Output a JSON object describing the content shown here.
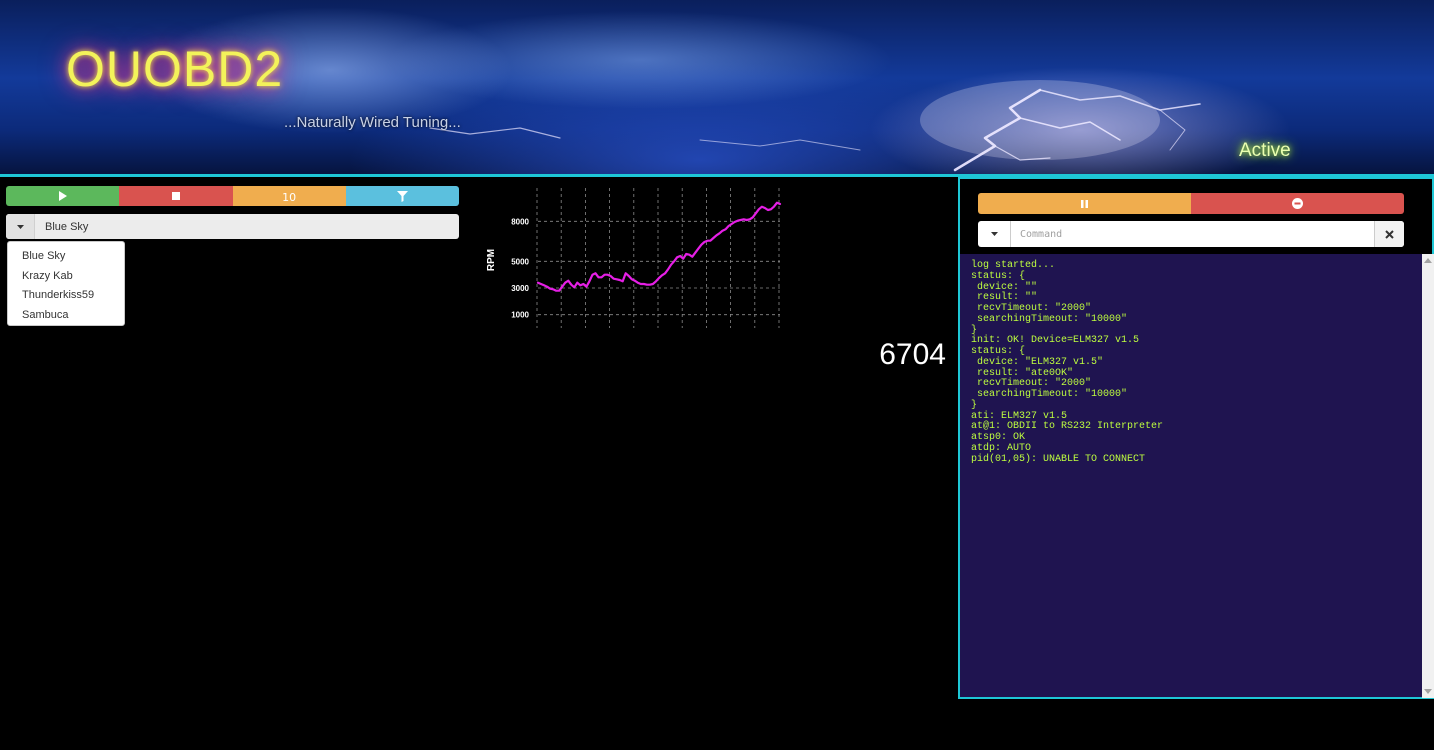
{
  "header": {
    "brand": "OUOBD2",
    "tagline": "...Naturally Wired Tuning...",
    "status": "Active",
    "accent_color": "#1ec7d6"
  },
  "controls": {
    "play_icon": "play-icon",
    "stop_icon": "stop-icon",
    "interval_label": "10",
    "filter_icon": "filter-icon"
  },
  "theme_select": {
    "selected": "Blue Sky",
    "options": [
      "Blue Sky",
      "Krazy Kab",
      "Thunderkiss59",
      "Sambuca"
    ]
  },
  "chart_data": {
    "type": "line",
    "title": "",
    "xlabel": "",
    "ylabel": "RPM",
    "yticks": [
      1000,
      3000,
      5000,
      8000
    ],
    "ylim": [
      0,
      10500
    ],
    "grid": true,
    "color": "#e61fe6",
    "x": [
      0,
      1,
      2,
      3,
      4,
      5,
      6,
      7,
      8,
      9,
      10,
      11,
      12,
      13,
      14,
      15,
      16,
      17,
      18,
      19,
      20,
      21,
      22,
      23,
      24,
      25,
      26,
      27,
      28,
      29,
      30,
      31,
      32,
      33,
      34,
      35,
      36,
      37,
      38,
      39,
      40,
      41,
      42,
      43,
      44,
      45,
      46,
      47,
      48,
      49,
      50,
      51,
      52,
      53,
      54,
      55,
      56,
      57,
      58,
      59,
      60,
      61,
      62,
      63,
      64,
      65,
      66,
      67,
      68,
      69,
      70,
      71,
      72,
      73,
      74,
      75,
      76,
      77,
      78,
      79,
      80
    ],
    "series": [
      {
        "values": [
          3400,
          3300,
          3200,
          3100,
          2950,
          2900,
          2800,
          2800,
          3100,
          3400,
          3550,
          3250,
          3050,
          3400,
          3200,
          3300,
          3100,
          3500,
          4000,
          4100,
          3800,
          3800,
          4000,
          4000,
          3900,
          3700,
          3650,
          3600,
          3500,
          4100,
          3900,
          3650,
          3550,
          3400,
          3300,
          3300,
          3250,
          3250,
          3300,
          3500,
          3750,
          3950,
          4100,
          4400,
          4750,
          5000,
          5300,
          5400,
          5200,
          5550,
          5500,
          5350,
          5650,
          5950,
          6250,
          6450,
          6550,
          6550,
          6750,
          6950,
          7100,
          7300,
          7400,
          7650,
          7800,
          7950,
          8050,
          8100,
          8150,
          8100,
          8150,
          8300,
          8600,
          8900,
          9100,
          9000,
          8850,
          8900,
          9100,
          9400,
          9300
        ]
      }
    ]
  },
  "rpm_readout": "6704",
  "console": {
    "pause_icon": "pause-icon",
    "clear_icon": "minus-circle-icon",
    "command_placeholder": "Command",
    "log": "log started...\nstatus: {\n device: \"\"\n result: \"\"\n recvTimeout: \"2000\"\n searchingTimeout: \"10000\"\n}\ninit: OK! Device=ELM327 v1.5\nstatus: {\n device: \"ELM327 v1.5\"\n result: \"ate0OK\"\n recvTimeout: \"2000\"\n searchingTimeout: \"10000\"\n}\nati: ELM327 v1.5\nat@1: OBDII to RS232 Interpreter\natsp0: OK\natdp: AUTO\npid(01,05): UNABLE TO CONNECT",
    "log_color": "#bfff3f",
    "log_background": "#1f1450"
  }
}
